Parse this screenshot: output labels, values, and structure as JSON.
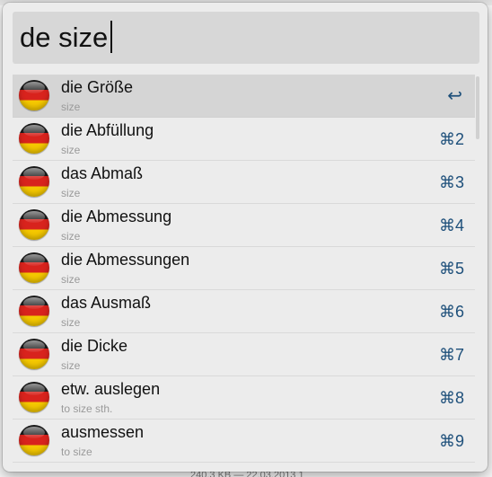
{
  "search": {
    "query": "de size"
  },
  "background": {
    "status_text": "240,3 KB — 22.03.2013 1"
  },
  "results": [
    {
      "title": "die Größe",
      "subtitle": "size",
      "shortcut": "↩",
      "icon": "german-flag-icon",
      "selected": true
    },
    {
      "title": "die Abfüllung",
      "subtitle": "size",
      "shortcut": "⌘2",
      "icon": "german-flag-icon"
    },
    {
      "title": "das Abmaß",
      "subtitle": "size",
      "shortcut": "⌘3",
      "icon": "german-flag-icon"
    },
    {
      "title": "die Abmessung",
      "subtitle": "size",
      "shortcut": "⌘4",
      "icon": "german-flag-icon"
    },
    {
      "title": "die Abmessungen",
      "subtitle": "size",
      "shortcut": "⌘5",
      "icon": "german-flag-icon"
    },
    {
      "title": "das Ausmaß",
      "subtitle": "size",
      "shortcut": "⌘6",
      "icon": "german-flag-icon"
    },
    {
      "title": "die Dicke",
      "subtitle": "size",
      "shortcut": "⌘7",
      "icon": "german-flag-icon"
    },
    {
      "title": "etw. auslegen",
      "subtitle": "to size sth.",
      "shortcut": "⌘8",
      "icon": "german-flag-icon"
    },
    {
      "title": "ausmessen",
      "subtitle": "to size",
      "shortcut": "⌘9",
      "icon": "german-flag-icon"
    }
  ],
  "colors": {
    "shortcut": "#1d4f7a",
    "selected_row": "#d5d5d5",
    "panel": "#ececec"
  }
}
